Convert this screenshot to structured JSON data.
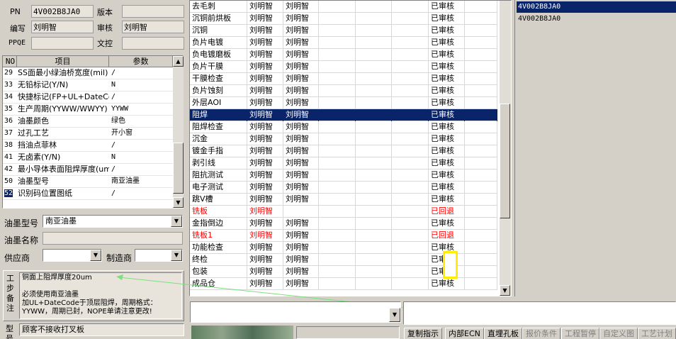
{
  "header": {
    "pn_label": "PN",
    "pn_value": "4V002B8JA0",
    "version_label": "版本",
    "version_value": "",
    "author_label": "编写",
    "author_value": "刘明智",
    "reviewer_label": "审核",
    "reviewer_value": "刘明智",
    "ppqe_label": "PPQE",
    "ppqe_value": "",
    "doc_ctrl_label": "文控",
    "doc_ctrl_value": ""
  },
  "params": {
    "col_no": "NO",
    "col_item": "项目",
    "col_value": "参数",
    "rows": [
      {
        "no": "29",
        "item": "SS面最小绿油桥宽度(mil)",
        "value": "/"
      },
      {
        "no": "33",
        "item": "无铅标记(Y/N)",
        "value": "N"
      },
      {
        "no": "34",
        "item": "快捷标记(FP+UL+DateCode)",
        "value": "/"
      },
      {
        "no": "35",
        "item": "生产周期(YYWW/WWYY)",
        "value": "YYWW"
      },
      {
        "no": "36",
        "item": "油墨颜色",
        "value": "绿色"
      },
      {
        "no": "37",
        "item": "过孔工艺",
        "value": "开小窗"
      },
      {
        "no": "38",
        "item": "挡油点菲林",
        "value": "/"
      },
      {
        "no": "41",
        "item": "无卤素(Y/N)",
        "value": "N"
      },
      {
        "no": "42",
        "item": "最小导体表面阻焊厚度(um)",
        "value": "/"
      },
      {
        "no": "50",
        "item": "油墨型号",
        "value": "南亚油墨"
      },
      {
        "no": "52",
        "item": "识别码位置图纸",
        "value": "/"
      }
    ]
  },
  "ink": {
    "model_label": "油墨型号",
    "model_value": "南亚油墨",
    "name_label": "油墨名称",
    "name_value": "",
    "supplier_label": "供应商",
    "supplier_value": "",
    "maker_label": "制造商",
    "maker_value": ""
  },
  "notes": {
    "label": "工步备注",
    "lines": [
      "铜面上阻焊厚度20um",
      "",
      "必须使用南亚油墨",
      "加UL+DateCode于顶层阻焊，周期格式：",
      "YYWW，周期已封，NOPE单请注意更改!"
    ],
    "type_label": "型号",
    "type_value": "顾客不接收打叉板"
  },
  "steps": [
    {
      "name": "去毛刺",
      "a": "刘明智",
      "b": "刘明智",
      "status": "已审核",
      "state": "ok"
    },
    {
      "name": "沉铜前烘板",
      "a": "刘明智",
      "b": "刘明智",
      "status": "已审核",
      "state": "ok"
    },
    {
      "name": "沉铜",
      "a": "刘明智",
      "b": "刘明智",
      "status": "已审核",
      "state": "ok"
    },
    {
      "name": "负片电镀",
      "a": "刘明智",
      "b": "刘明智",
      "status": "已审核",
      "state": "ok"
    },
    {
      "name": "负电镀磨板",
      "a": "刘明智",
      "b": "刘明智",
      "status": "已审核",
      "state": "ok"
    },
    {
      "name": "负片干膜",
      "a": "刘明智",
      "b": "刘明智",
      "status": "已审核",
      "state": "ok"
    },
    {
      "name": "干膜检查",
      "a": "刘明智",
      "b": "刘明智",
      "status": "已审核",
      "state": "ok"
    },
    {
      "name": "负片蚀刻",
      "a": "刘明智",
      "b": "刘明智",
      "status": "已审核",
      "state": "ok"
    },
    {
      "name": "外层AOI",
      "a": "刘明智",
      "b": "刘明智",
      "status": "已审核",
      "state": "ok"
    },
    {
      "name": "阻焊",
      "a": "刘明智",
      "b": "刘明智",
      "status": "已审核",
      "state": "selected"
    },
    {
      "name": "阻焊检查",
      "a": "刘明智",
      "b": "刘明智",
      "status": "已审核",
      "state": "ok"
    },
    {
      "name": "沉金",
      "a": "刘明智",
      "b": "刘明智",
      "status": "已审核",
      "state": "ok"
    },
    {
      "name": "镀金手指",
      "a": "刘明智",
      "b": "刘明智",
      "status": "已审核",
      "state": "ok"
    },
    {
      "name": "剥引线",
      "a": "刘明智",
      "b": "刘明智",
      "status": "已审核",
      "state": "ok"
    },
    {
      "name": "阻抗测试",
      "a": "刘明智",
      "b": "刘明智",
      "status": "已审核",
      "state": "ok"
    },
    {
      "name": "电子测试",
      "a": "刘明智",
      "b": "刘明智",
      "status": "已审核",
      "state": "ok"
    },
    {
      "name": "跳V槽",
      "a": "刘明智",
      "b": "刘明智",
      "status": "已审核",
      "state": "ok"
    },
    {
      "name": "铣板",
      "a": "刘明智",
      "b": "",
      "status": "已回退",
      "state": "rejected"
    },
    {
      "name": "金指倒边",
      "a": "刘明智",
      "b": "刘明智",
      "status": "已审核",
      "state": "ok"
    },
    {
      "name": "铣板1",
      "a": "刘明智",
      "b": "刘明智",
      "status": "已回退",
      "state": "rejected"
    },
    {
      "name": "功能检查",
      "a": "刘明智",
      "b": "刘明智",
      "status": "已审核",
      "state": "ok"
    },
    {
      "name": "终检",
      "a": "刘明智",
      "b": "刘明智",
      "status": "已审核",
      "state": "ok"
    },
    {
      "name": "包装",
      "a": "刘明智",
      "b": "刘明智",
      "status": "已审核",
      "state": "ok"
    },
    {
      "name": "成品仓",
      "a": "刘明智",
      "b": "刘明智",
      "status": "已审核",
      "state": "ok"
    }
  ],
  "right_list": [
    "4V002B8JA0",
    "4V002B8JA0"
  ],
  "tabs": [
    "复制指示",
    "内部ECN",
    "直埋孔板",
    "报价条件",
    "工程暂停",
    "自定义图",
    "工艺计划"
  ],
  "colors": {
    "selection": "#0a246a",
    "rejected": "#ff0000",
    "highlight_box": "#ffee00"
  }
}
